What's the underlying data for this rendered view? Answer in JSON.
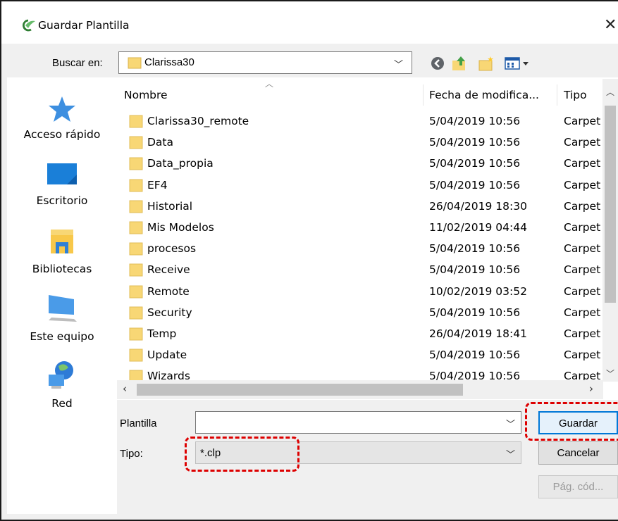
{
  "window": {
    "title": "Guardar Plantilla",
    "close_glyph": "✕"
  },
  "location": {
    "label": "Buscar en:",
    "value": "Clarissa30"
  },
  "sidebar": {
    "items": [
      {
        "label": "Acceso rápido",
        "icon": "star-icon"
      },
      {
        "label": "Escritorio",
        "icon": "desktop-icon"
      },
      {
        "label": "Bibliotecas",
        "icon": "libraries-icon"
      },
      {
        "label": "Este equipo",
        "icon": "computer-icon"
      },
      {
        "label": "Red",
        "icon": "network-icon"
      }
    ]
  },
  "columns": {
    "name": "Nombre",
    "date": "Fecha de modifica...",
    "type": "Tipo"
  },
  "files": [
    {
      "name": "Clarissa30_remote",
      "date": "5/04/2019 10:56",
      "type": "Carpet"
    },
    {
      "name": "Data",
      "date": "5/04/2019 10:56",
      "type": "Carpet"
    },
    {
      "name": "Data_propia",
      "date": "5/04/2019 10:56",
      "type": "Carpet"
    },
    {
      "name": "EF4",
      "date": "5/04/2019 10:56",
      "type": "Carpet"
    },
    {
      "name": "Historial",
      "date": "26/04/2019 18:30",
      "type": "Carpet"
    },
    {
      "name": "Mis Modelos",
      "date": "11/02/2019 04:44",
      "type": "Carpet"
    },
    {
      "name": "procesos",
      "date": "5/04/2019 10:56",
      "type": "Carpet"
    },
    {
      "name": "Receive",
      "date": "5/04/2019 10:56",
      "type": "Carpet"
    },
    {
      "name": "Remote",
      "date": "10/02/2019 03:52",
      "type": "Carpet"
    },
    {
      "name": "Security",
      "date": "5/04/2019 10:56",
      "type": "Carpet"
    },
    {
      "name": "Temp",
      "date": "26/04/2019 18:41",
      "type": "Carpet"
    },
    {
      "name": "Update",
      "date": "5/04/2019 10:56",
      "type": "Carpet"
    },
    {
      "name": "Wizards",
      "date": "5/04/2019 10:56",
      "type": "Carpet"
    }
  ],
  "form": {
    "filename_label": "Plantilla",
    "filename_value": "",
    "type_label": "Tipo:",
    "type_value": "*.clp"
  },
  "buttons": {
    "save": "Guardar",
    "cancel": "Cancelar",
    "codepage": "Pág. cód..."
  },
  "colors": {
    "highlight": "#dd0000",
    "folder": "#f8d775",
    "accent": "#0078d7"
  }
}
